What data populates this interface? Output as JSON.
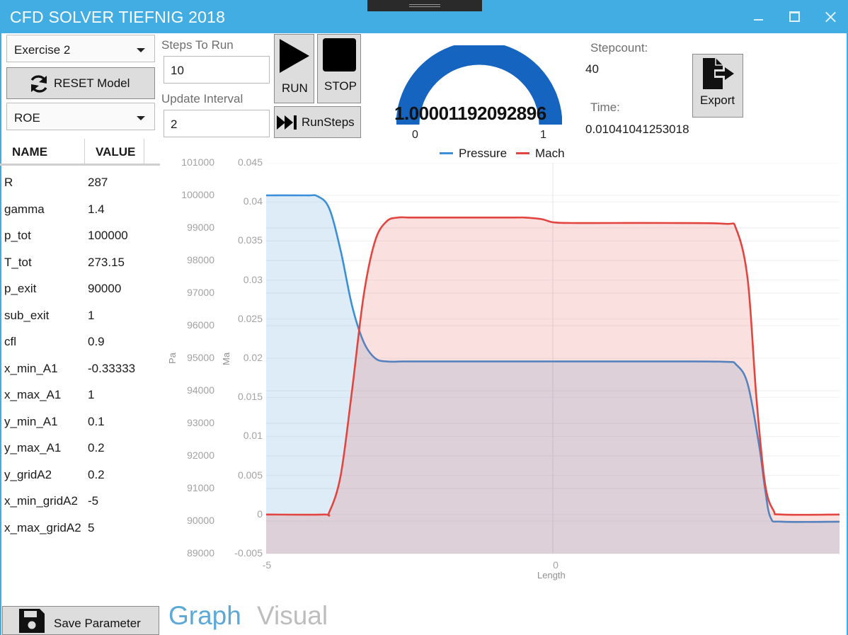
{
  "app": {
    "title": "CFD SOLVER TIEFNIG 2018"
  },
  "colors": {
    "titlebar": "#41ade2",
    "gauge": "#1565c0",
    "pressure": "#3a8fd8",
    "mach": "#e2453f",
    "tab_active": "#5ba9d9",
    "tab_inactive": "#bdbdbd"
  },
  "controls": {
    "exercise": "Exercise 2",
    "reset_label": "RESET Model",
    "scheme": "ROE",
    "steps_to_run_label": "Steps To Run",
    "steps_to_run_value": "10",
    "update_interval_label": "Update Interval",
    "update_interval_value": "2",
    "run_label": "RUN",
    "stop_label": "STOP",
    "runsteps_label": "RunSteps",
    "export_label": "Export",
    "save_label": "Save Parameter"
  },
  "gauge": {
    "value": "1.00001192092896",
    "level": 1.0,
    "min": "0",
    "max": "1"
  },
  "status": {
    "stepcount_label": "Stepcount:",
    "stepcount_value": "40",
    "time_label": "Time:",
    "time_value": "0.01041041253018"
  },
  "params": {
    "headers": [
      "NAME",
      "VALUE"
    ],
    "rows": [
      [
        "R",
        "287"
      ],
      [
        "gamma",
        "1.4"
      ],
      [
        "p_tot",
        "100000"
      ],
      [
        "T_tot",
        "273.15"
      ],
      [
        "p_exit",
        "90000"
      ],
      [
        "sub_exit",
        "1"
      ],
      [
        "cfl",
        "0.9"
      ],
      [
        "x_min_A1",
        "-0.33333"
      ],
      [
        "x_max_A1",
        "1"
      ],
      [
        "y_min_A1",
        "0.1"
      ],
      [
        "y_max_A1",
        "0.2"
      ],
      [
        "y_gridA2",
        "0.2"
      ],
      [
        "x_min_gridA2",
        "-5"
      ],
      [
        "x_max_gridA2",
        "5"
      ]
    ]
  },
  "tabs": {
    "graph": "Graph",
    "visual": "Visual"
  },
  "chart_data": {
    "type": "area",
    "xlabel": "Length",
    "y1label": "Pa",
    "y2label": "Ma",
    "x_ticks": [
      "-5",
      "0"
    ],
    "y1_ticks": [
      "101000",
      "100000",
      "99000",
      "98000",
      "97000",
      "96000",
      "95000",
      "94000",
      "93000",
      "92000",
      "91000",
      "90000",
      "89000"
    ],
    "y2_ticks": [
      "0.045",
      "0.04",
      "0.035",
      "0.03",
      "0.025",
      "0.02",
      "0.015",
      "0.01",
      "0.005",
      "0",
      "-0.005"
    ],
    "xlim": [
      -5,
      5
    ],
    "y1lim": [
      89000,
      101000
    ],
    "y2lim": [
      -0.005,
      0.045
    ],
    "grid": true,
    "legend": "top",
    "series": [
      {
        "name": "Pressure",
        "axis": "left",
        "x": [
          -5,
          -4.3,
          -4.1,
          -3.9,
          -3.7,
          -3.5,
          -3.3,
          -3.1,
          -2.9,
          -2.6,
          -2.2,
          -1,
          0,
          1,
          2,
          3.0,
          3.2,
          3.4,
          3.6,
          3.7,
          3.8,
          4,
          5
        ],
        "y": [
          100000,
          100000,
          99970,
          99600,
          98300,
          96600,
          95500,
          95000,
          94900,
          94900,
          94900,
          94900,
          94900,
          94900,
          94900,
          94890,
          94800,
          94200,
          92300,
          91000,
          90100,
          89980,
          89980
        ]
      },
      {
        "name": "Mach",
        "axis": "right",
        "x": [
          -5,
          -4.0,
          -3.9,
          -3.7,
          -3.5,
          -3.3,
          -3.1,
          -2.9,
          -2.7,
          -2.5,
          -2,
          -0.7,
          -0.5,
          -0.2,
          0,
          0.3,
          1,
          2,
          3.0,
          3.2,
          3.4,
          3.55,
          3.7,
          3.85,
          4,
          5
        ],
        "y": [
          0,
          0,
          0.0003,
          0.005,
          0.016,
          0.028,
          0.035,
          0.0375,
          0.038,
          0.038,
          0.038,
          0.038,
          0.038,
          0.0378,
          0.0374,
          0.0373,
          0.0373,
          0.0373,
          0.0372,
          0.0365,
          0.03,
          0.015,
          0.004,
          0.0005,
          0,
          0
        ]
      }
    ]
  }
}
